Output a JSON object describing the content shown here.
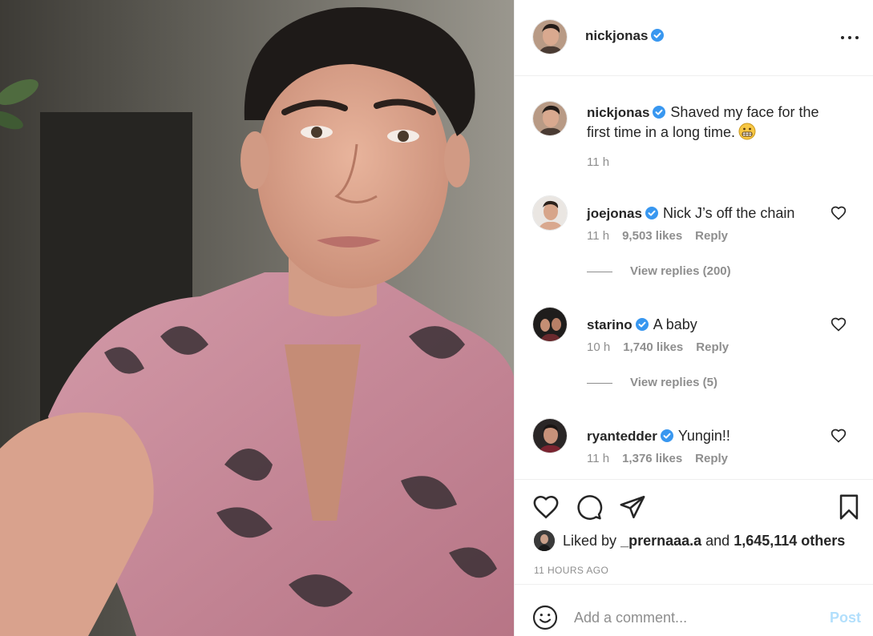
{
  "post": {
    "author": "nickjonas",
    "verified": true,
    "caption_text": "Shaved my face for the first time in a long time.",
    "caption_emoji": "grimacing-face-icon",
    "caption_time": "11 h"
  },
  "comments": [
    {
      "username": "joejonas",
      "verified": true,
      "text": "Nick J’s off the chain",
      "time": "11 h",
      "likes": "9,503 likes",
      "reply_label": "Reply",
      "view_replies": "View replies (200)"
    },
    {
      "username": "starino",
      "verified": true,
      "text": "A baby",
      "time": "10 h",
      "likes": "1,740 likes",
      "reply_label": "Reply",
      "view_replies": "View replies (5)"
    },
    {
      "username": "ryantedder",
      "verified": true,
      "text": "Yungin!!",
      "time": "11 h",
      "likes": "1,376 likes",
      "reply_label": "Reply"
    }
  ],
  "engagement": {
    "liked_by_prefix": "Liked by",
    "liked_by_user": "_prernaaa.a",
    "liked_by_and": "and",
    "liked_by_count": "1,645,114 others",
    "timestamp": "11 HOURS AGO"
  },
  "composer": {
    "placeholder": "Add a comment...",
    "post_label": "Post"
  },
  "icons": {
    "like": "heart-icon",
    "comment": "comment-bubble-icon",
    "share": "paper-plane-icon",
    "save": "bookmark-icon",
    "more": "more-options-icon",
    "emoji": "smiley-icon"
  },
  "colors": {
    "verified_blue": "#3897f0",
    "post_button_disabled": "#b2dffc",
    "secondary_text": "#8e8e8e",
    "shirt_pink": "#c9899a"
  }
}
